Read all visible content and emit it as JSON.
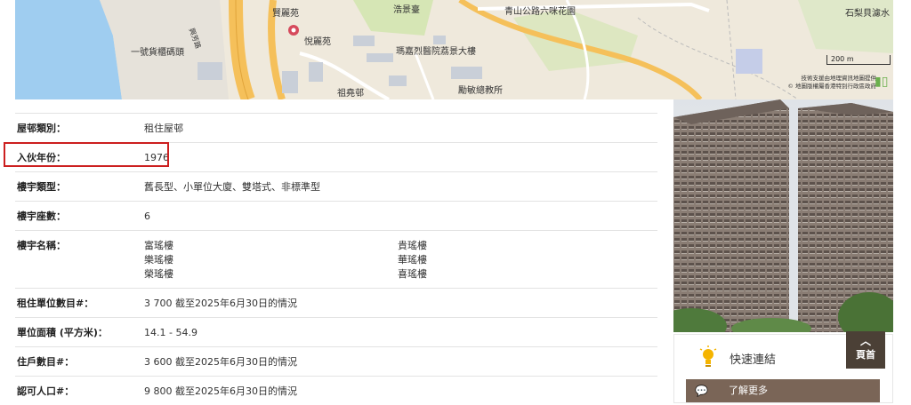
{
  "map": {
    "labels": {
      "fuk_lai": "賢麗苑",
      "yuet_lai": "悅麗苑",
      "ho_king": "浩景臺",
      "castle_peak_road": "青山公路六咪花園",
      "tseuk_lei": "石梨貝濾水",
      "pier": "一號貨櫃碼頭",
      "hing_fong": "興芳路",
      "yan_chai": "瑪嘉烈醫院荔景大樓",
      "tsui_yiu": "祖堯邨",
      "school": "勵敏總教所"
    },
    "scale": "200 m",
    "credit_line1": "技術支援由地理資訊地圖提供",
    "credit_line2": "© 地圖版權屬香港特別行政區政府",
    "colors": {
      "land": "#efe9dc",
      "water": "#9fcdf0",
      "road_major": "#f5c05a",
      "road_minor": "#ffffff",
      "park": "#d6e6b5"
    }
  },
  "info": {
    "type_label": "屋邨類別：",
    "type_value": "租住屋邨",
    "year_label": "入伙年份：",
    "year_value": "1976",
    "block_type_label": "樓宇類型：",
    "block_type_value": "舊長型、小單位大廈、雙塔式、非標準型",
    "block_count_label": "樓宇座數：",
    "block_count_value": "6",
    "block_names_label": "樓宇名稱：",
    "block_names": [
      "富瑤樓",
      "貴瑤樓",
      "樂瑤樓",
      "華瑤樓",
      "榮瑤樓",
      "喜瑤樓"
    ],
    "units_label": "租住單位數目#：",
    "units_value": "3 700 截至2025年6月30日的情況",
    "area_label": "單位面積 (平方米)：",
    "area_value": "14.1 - 54.9",
    "households_label": "住戶數目#：",
    "households_value": "3 600 截至2025年6月30日的情況",
    "population_label": "認可人口#：",
    "population_value": "9 800 截至2025年6月30日的情況",
    "highlight_color": "#cc1f1f"
  },
  "sidebar": {
    "quick_links_title": "快速連結",
    "learn_more": "了解更多",
    "top_button": "頁首",
    "bar_color": "#7a6557",
    "top_color": "#4b4036",
    "icons": {
      "bulb": "lightbulb-icon",
      "chat": "chat-bubble-icon",
      "top": "chevron-up-icon"
    }
  }
}
